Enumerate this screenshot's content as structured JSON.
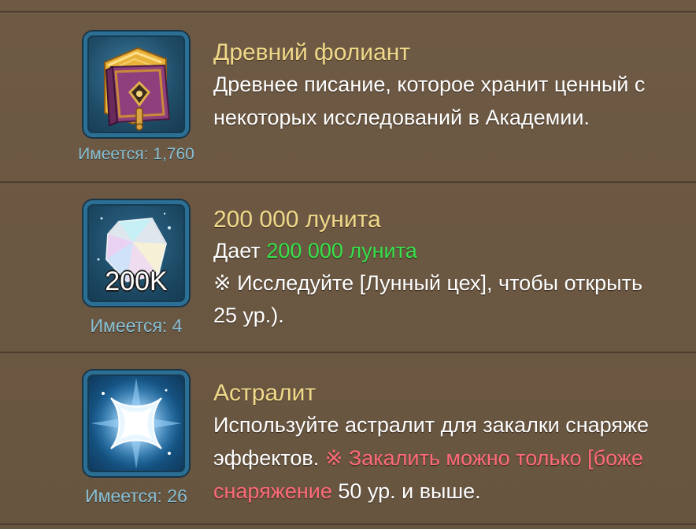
{
  "items": [
    {
      "title": "Древний фолиант",
      "desc_line1": "Древнее писание, которое хранит ценный с",
      "desc_line2": "некоторых исследований в Академии.",
      "owned": "Имеется: 1,760",
      "icon": "ancient-tome-icon"
    },
    {
      "title": "200 000 лунита",
      "desc_line1_prefix": "Дает ",
      "desc_line1_highlight": "200 000 лунита",
      "desc_line2": "※ Исследуйте [Лунный цех], чтобы открыть",
      "desc_line3": "25 ур.).",
      "badge": "200K",
      "owned": "Имеется: 4",
      "icon": "lunite-crystal-icon"
    },
    {
      "title": "Астралит",
      "desc_line1": "Используйте астралит для закалки снаряже",
      "desc_line2_prefix": "эффектов. ",
      "desc_line2_warning": "※ Закалить можно только [боже",
      "desc_line3_warning": "снаряжение",
      "desc_line3_suffix": " 50 ур. и выше.",
      "owned": "Имеется: 26",
      "icon": "astralite-star-icon"
    }
  ],
  "colors": {
    "title": "#f1d98a",
    "owned": "#89c1d6",
    "highlight_green": "#37e24b",
    "warning_pink": "#ff6b7a",
    "frame_blue": "#2c6f95"
  }
}
